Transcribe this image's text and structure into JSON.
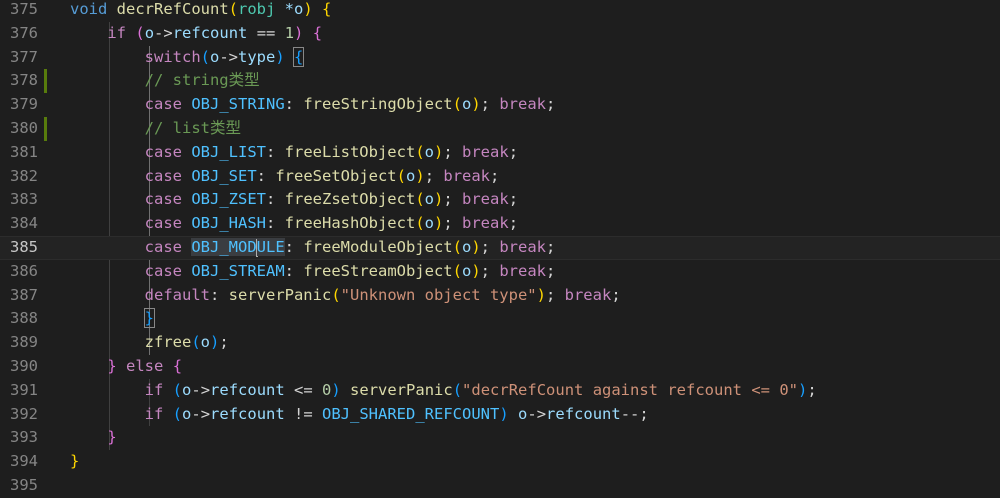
{
  "editor": {
    "current_line": "385",
    "lines": [
      {
        "no": "375",
        "tokens": [
          {
            "t": "void",
            "c": "kw"
          },
          {
            "t": " "
          },
          {
            "t": "decrRefCount",
            "c": "fn"
          },
          {
            "t": "(",
            "c": "p1"
          },
          {
            "t": "robj",
            "c": "ty"
          },
          {
            "t": " "
          },
          {
            "t": "*",
            "c": "var"
          },
          {
            "t": "o",
            "c": "var"
          },
          {
            "t": ")",
            "c": "p1"
          },
          {
            "t": " "
          },
          {
            "t": "{",
            "c": "p1"
          }
        ]
      },
      {
        "no": "376",
        "tokens": [
          {
            "t": "    "
          },
          {
            "t": "if",
            "c": "ctl"
          },
          {
            "t": " "
          },
          {
            "t": "(",
            "c": "p2"
          },
          {
            "t": "o",
            "c": "var"
          },
          {
            "t": "->"
          },
          {
            "t": "refcount",
            "c": "var"
          },
          {
            "t": " == "
          },
          {
            "t": "1",
            "c": "num"
          },
          {
            "t": ")",
            "c": "p2"
          },
          {
            "t": " "
          },
          {
            "t": "{",
            "c": "p2"
          }
        ]
      },
      {
        "no": "377",
        "tokens": [
          {
            "t": "        "
          },
          {
            "t": "switch",
            "c": "ctl"
          },
          {
            "t": "(",
            "c": "p3"
          },
          {
            "t": "o",
            "c": "var"
          },
          {
            "t": "->"
          },
          {
            "t": "type",
            "c": "var"
          },
          {
            "t": ")",
            "c": "p3"
          },
          {
            "t": " "
          },
          {
            "t": "{",
            "c": "p3 bm"
          }
        ]
      },
      {
        "no": "378",
        "tokens": [
          {
            "t": "        "
          },
          {
            "t": "// string类型",
            "c": "cmt"
          }
        ]
      },
      {
        "no": "379",
        "tokens": [
          {
            "t": "        "
          },
          {
            "t": "case",
            "c": "ctl"
          },
          {
            "t": " "
          },
          {
            "t": "OBJ_STRING",
            "c": "cst"
          },
          {
            "t": ": "
          },
          {
            "t": "freeStringObject",
            "c": "fn"
          },
          {
            "t": "(",
            "c": "p1"
          },
          {
            "t": "o",
            "c": "var"
          },
          {
            "t": ")",
            "c": "p1"
          },
          {
            "t": "; "
          },
          {
            "t": "break",
            "c": "ctl"
          },
          {
            "t": ";"
          }
        ]
      },
      {
        "no": "380",
        "tokens": [
          {
            "t": "        "
          },
          {
            "t": "// list类型",
            "c": "cmt"
          }
        ]
      },
      {
        "no": "381",
        "tokens": [
          {
            "t": "        "
          },
          {
            "t": "case",
            "c": "ctl"
          },
          {
            "t": " "
          },
          {
            "t": "OBJ_LIST",
            "c": "cst"
          },
          {
            "t": ": "
          },
          {
            "t": "freeListObject",
            "c": "fn"
          },
          {
            "t": "(",
            "c": "p1"
          },
          {
            "t": "o",
            "c": "var"
          },
          {
            "t": ")",
            "c": "p1"
          },
          {
            "t": "; "
          },
          {
            "t": "break",
            "c": "ctl"
          },
          {
            "t": ";"
          }
        ]
      },
      {
        "no": "382",
        "tokens": [
          {
            "t": "        "
          },
          {
            "t": "case",
            "c": "ctl"
          },
          {
            "t": " "
          },
          {
            "t": "OBJ_SET",
            "c": "cst"
          },
          {
            "t": ": "
          },
          {
            "t": "freeSetObject",
            "c": "fn"
          },
          {
            "t": "(",
            "c": "p1"
          },
          {
            "t": "o",
            "c": "var"
          },
          {
            "t": ")",
            "c": "p1"
          },
          {
            "t": "; "
          },
          {
            "t": "break",
            "c": "ctl"
          },
          {
            "t": ";"
          }
        ]
      },
      {
        "no": "383",
        "tokens": [
          {
            "t": "        "
          },
          {
            "t": "case",
            "c": "ctl"
          },
          {
            "t": " "
          },
          {
            "t": "OBJ_ZSET",
            "c": "cst"
          },
          {
            "t": ": "
          },
          {
            "t": "freeZsetObject",
            "c": "fn"
          },
          {
            "t": "(",
            "c": "p1"
          },
          {
            "t": "o",
            "c": "var"
          },
          {
            "t": ")",
            "c": "p1"
          },
          {
            "t": "; "
          },
          {
            "t": "break",
            "c": "ctl"
          },
          {
            "t": ";"
          }
        ]
      },
      {
        "no": "384",
        "tokens": [
          {
            "t": "        "
          },
          {
            "t": "case",
            "c": "ctl"
          },
          {
            "t": " "
          },
          {
            "t": "OBJ_HASH",
            "c": "cst"
          },
          {
            "t": ": "
          },
          {
            "t": "freeHashObject",
            "c": "fn"
          },
          {
            "t": "(",
            "c": "p1"
          },
          {
            "t": "o",
            "c": "var"
          },
          {
            "t": ")",
            "c": "p1"
          },
          {
            "t": "; "
          },
          {
            "t": "break",
            "c": "ctl"
          },
          {
            "t": ";"
          }
        ]
      },
      {
        "no": "385",
        "tokens": [
          {
            "t": "        "
          },
          {
            "t": "case",
            "c": "ctl"
          },
          {
            "t": " "
          },
          {
            "t": "OBJ_MOD",
            "c": "cst sel"
          },
          {
            "t": "",
            "c": "cursor"
          },
          {
            "t": "ULE",
            "c": "cst sel"
          },
          {
            "t": ": "
          },
          {
            "t": "freeModuleObject",
            "c": "fn"
          },
          {
            "t": "(",
            "c": "p1"
          },
          {
            "t": "o",
            "c": "var"
          },
          {
            "t": ")",
            "c": "p1"
          },
          {
            "t": "; "
          },
          {
            "t": "break",
            "c": "ctl"
          },
          {
            "t": ";"
          }
        ]
      },
      {
        "no": "386",
        "tokens": [
          {
            "t": "        "
          },
          {
            "t": "case",
            "c": "ctl"
          },
          {
            "t": " "
          },
          {
            "t": "OBJ_STREAM",
            "c": "cst"
          },
          {
            "t": ": "
          },
          {
            "t": "freeStreamObject",
            "c": "fn"
          },
          {
            "t": "(",
            "c": "p1"
          },
          {
            "t": "o",
            "c": "var"
          },
          {
            "t": ")",
            "c": "p1"
          },
          {
            "t": "; "
          },
          {
            "t": "break",
            "c": "ctl"
          },
          {
            "t": ";"
          }
        ]
      },
      {
        "no": "387",
        "tokens": [
          {
            "t": "        "
          },
          {
            "t": "default",
            "c": "ctl"
          },
          {
            "t": ": "
          },
          {
            "t": "serverPanic",
            "c": "fn"
          },
          {
            "t": "(",
            "c": "p1"
          },
          {
            "t": "\"Unknown object type\"",
            "c": "str"
          },
          {
            "t": ")",
            "c": "p1"
          },
          {
            "t": "; "
          },
          {
            "t": "break",
            "c": "ctl"
          },
          {
            "t": ";"
          }
        ]
      },
      {
        "no": "388",
        "tokens": [
          {
            "t": "        "
          },
          {
            "t": "}",
            "c": "p3 bm"
          }
        ]
      },
      {
        "no": "389",
        "tokens": [
          {
            "t": "        "
          },
          {
            "t": "zfree",
            "c": "fn"
          },
          {
            "t": "(",
            "c": "p3"
          },
          {
            "t": "o",
            "c": "var"
          },
          {
            "t": ")",
            "c": "p3"
          },
          {
            "t": ";"
          }
        ]
      },
      {
        "no": "390",
        "tokens": [
          {
            "t": "    "
          },
          {
            "t": "}",
            "c": "p2"
          },
          {
            "t": " "
          },
          {
            "t": "else",
            "c": "ctl"
          },
          {
            "t": " "
          },
          {
            "t": "{",
            "c": "p2"
          }
        ]
      },
      {
        "no": "391",
        "tokens": [
          {
            "t": "        "
          },
          {
            "t": "if",
            "c": "ctl"
          },
          {
            "t": " "
          },
          {
            "t": "(",
            "c": "p3"
          },
          {
            "t": "o",
            "c": "var"
          },
          {
            "t": "->"
          },
          {
            "t": "refcount",
            "c": "var"
          },
          {
            "t": " <= "
          },
          {
            "t": "0",
            "c": "num"
          },
          {
            "t": ")",
            "c": "p3"
          },
          {
            "t": " "
          },
          {
            "t": "serverPanic",
            "c": "fn"
          },
          {
            "t": "(",
            "c": "p3"
          },
          {
            "t": "\"decrRefCount against refcount <= 0\"",
            "c": "str"
          },
          {
            "t": ")",
            "c": "p3"
          },
          {
            "t": ";"
          }
        ]
      },
      {
        "no": "392",
        "tokens": [
          {
            "t": "        "
          },
          {
            "t": "if",
            "c": "ctl"
          },
          {
            "t": " "
          },
          {
            "t": "(",
            "c": "p3"
          },
          {
            "t": "o",
            "c": "var"
          },
          {
            "t": "->"
          },
          {
            "t": "refcount",
            "c": "var"
          },
          {
            "t": " != "
          },
          {
            "t": "OBJ_SHARED_REFCOUNT",
            "c": "cst"
          },
          {
            "t": ")",
            "c": "p3"
          },
          {
            "t": " "
          },
          {
            "t": "o",
            "c": "var"
          },
          {
            "t": "->"
          },
          {
            "t": "refcount",
            "c": "var"
          },
          {
            "t": "--;"
          }
        ]
      },
      {
        "no": "393",
        "tokens": [
          {
            "t": "    "
          },
          {
            "t": "}",
            "c": "p2"
          }
        ]
      },
      {
        "no": "394",
        "tokens": [
          {
            "t": "}",
            "c": "p1"
          }
        ]
      },
      {
        "no": "395",
        "tokens": []
      }
    ],
    "modified_lines": [
      "378",
      "380"
    ]
  }
}
